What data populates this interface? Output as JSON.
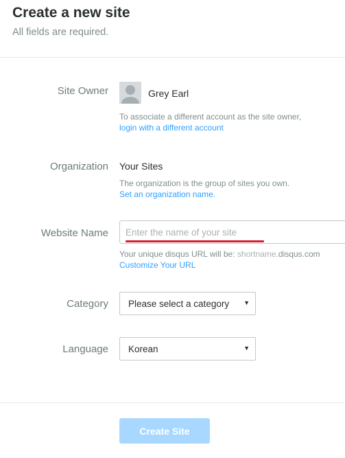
{
  "header": {
    "title": "Create a new site",
    "subtitle": "All fields are required."
  },
  "site_owner": {
    "label": "Site Owner",
    "name": "Grey Earl",
    "help": "To associate a different account as the site owner,",
    "link": "login with a different account"
  },
  "organization": {
    "label": "Organization",
    "name": "Your Sites",
    "help": "The organization is the group of sites you own.",
    "link": "Set an organization name."
  },
  "website_name": {
    "label": "Website Name",
    "placeholder": "Enter the name of your site",
    "value": "",
    "url_prefix": "Your unique disqus URL will be: ",
    "url_shortname": "shortname",
    "url_suffix": ".disqus.com",
    "customize_link": "Customize Your URL"
  },
  "category": {
    "label": "Category",
    "selected": "Please select a category"
  },
  "language": {
    "label": "Language",
    "selected": "Korean"
  },
  "actions": {
    "create_label": "Create Site"
  },
  "colors": {
    "link": "#2e9fff",
    "button_disabled": "#a8d8ff",
    "annotation_underline": "#d4202c"
  }
}
